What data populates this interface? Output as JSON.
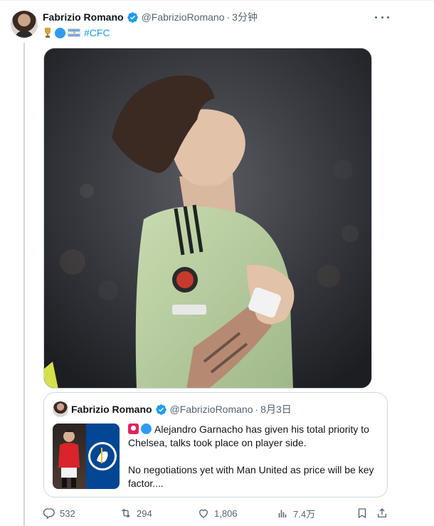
{
  "tweet": {
    "author_name": "Fabrizio Romano",
    "handle": "@FabrizioRomano",
    "separator": "·",
    "time": "3分钟",
    "hashtag": "#CFC",
    "emojis": [
      "trophy",
      "blue-circle",
      "argentina-flag"
    ]
  },
  "quoted_tweet": {
    "author_name": "Fabrizio Romano",
    "handle": "@FabrizioRomano",
    "separator": "·",
    "date": "8月3日",
    "text_line1": "Alejandro Garnacho has given his total priority to Chelsea, talks took place on player side.",
    "text_line2": "No negotiations yet with Man United as price will be key factor....",
    "emojis": [
      "red-alarm",
      "blue-circle"
    ]
  },
  "actions": {
    "replies": "532",
    "reposts": "294",
    "likes": "1,806",
    "views": "7.4万"
  },
  "colors": {
    "link_blue": "#1d9bf0",
    "text_primary": "#0f1419",
    "text_secondary": "#536471",
    "border": "#cfd9de",
    "chelsea_blue": "#034694"
  },
  "icons": [
    "verified-badge-icon",
    "more-icon",
    "reply-icon",
    "repost-icon",
    "like-icon",
    "views-icon",
    "bookmark-icon",
    "share-icon"
  ]
}
